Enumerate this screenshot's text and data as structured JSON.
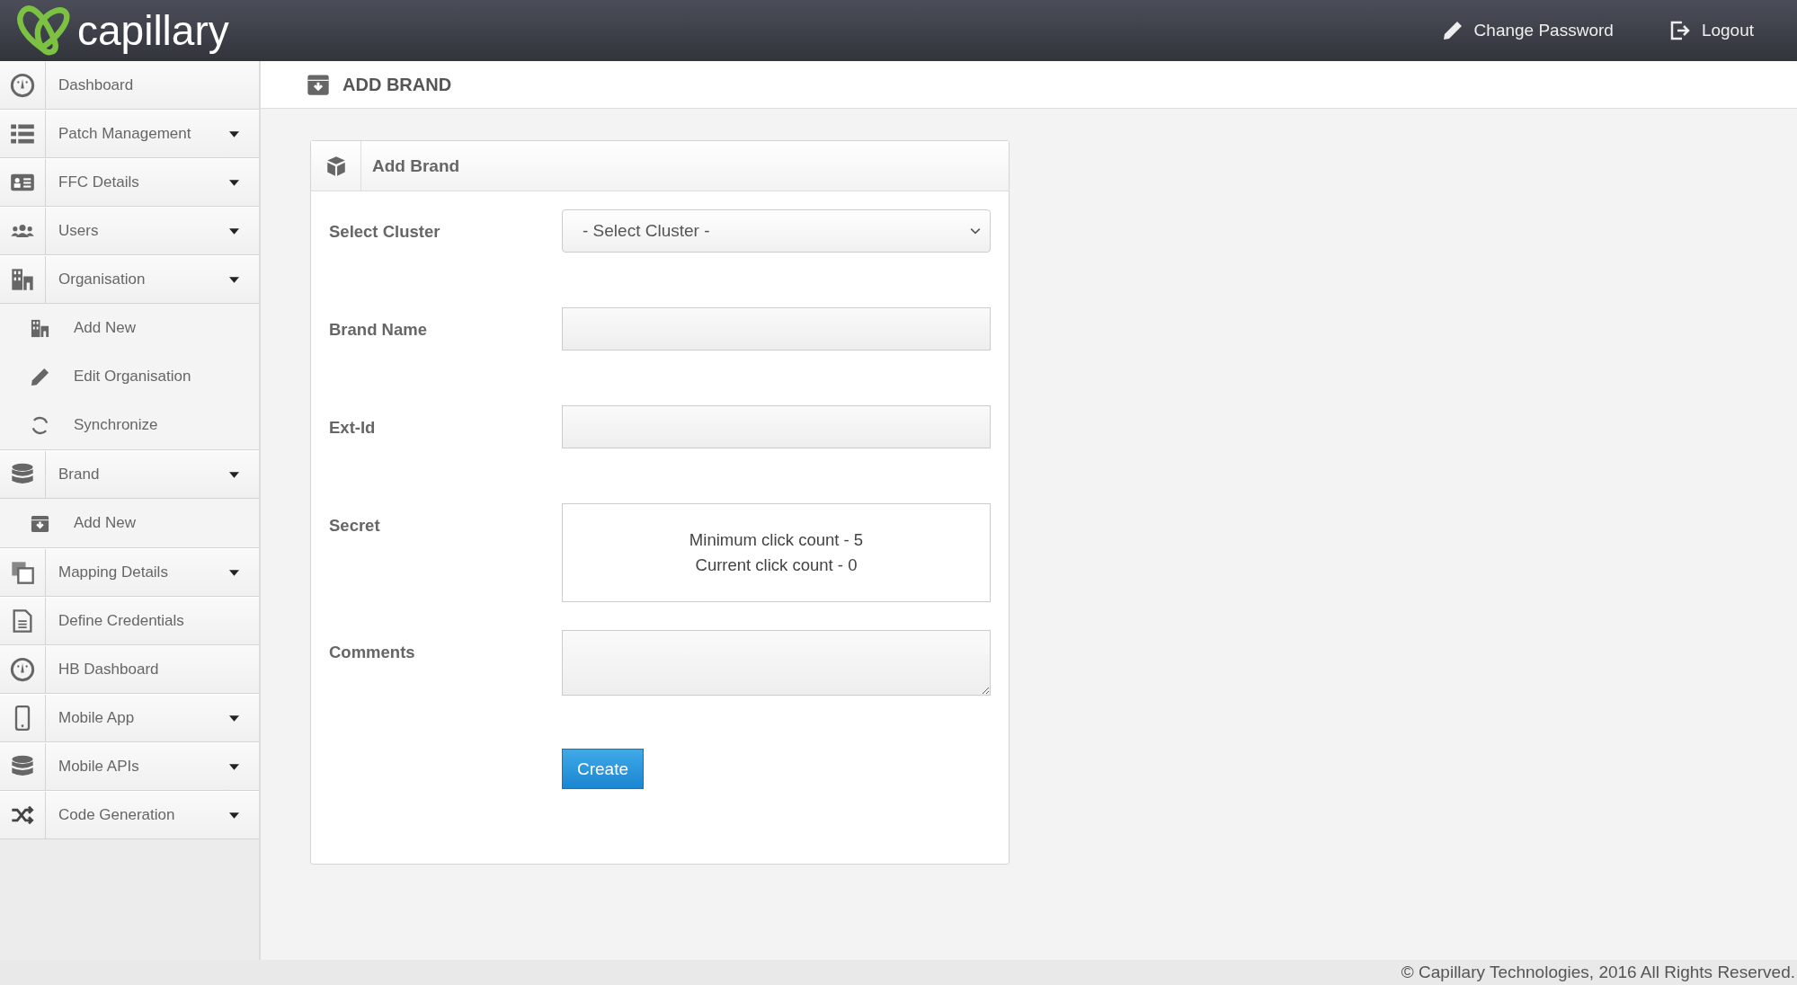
{
  "header": {
    "logo": "capillary",
    "links": [
      {
        "label": "Change Password"
      },
      {
        "label": "Logout"
      }
    ]
  },
  "sidebar": {
    "items": [
      {
        "label": "Dashboard",
        "dropdown": false
      },
      {
        "label": "Patch Management",
        "dropdown": true
      },
      {
        "label": "FFC Details",
        "dropdown": true
      },
      {
        "label": "Users",
        "dropdown": true
      },
      {
        "label": "Organisation",
        "dropdown": true,
        "children": [
          {
            "label": "Add New"
          },
          {
            "label": "Edit Organisation"
          },
          {
            "label": "Synchronize"
          }
        ]
      },
      {
        "label": "Brand",
        "dropdown": true,
        "children": [
          {
            "label": "Add New"
          }
        ]
      },
      {
        "label": "Mapping Details",
        "dropdown": true
      },
      {
        "label": "Define Credentials",
        "dropdown": false
      },
      {
        "label": "HB Dashboard",
        "dropdown": false
      },
      {
        "label": "Mobile App",
        "dropdown": true
      },
      {
        "label": "Mobile APIs",
        "dropdown": true
      },
      {
        "label": "Code Generation",
        "dropdown": true
      }
    ]
  },
  "page": {
    "title": "ADD BRAND"
  },
  "form": {
    "title": "Add Brand",
    "fields": [
      {
        "label": "Select Cluster",
        "kind": "select",
        "value": "- Select Cluster -"
      },
      {
        "label": "Brand Name",
        "kind": "text"
      },
      {
        "label": "Ext-Id",
        "kind": "text"
      },
      {
        "label": "Secret",
        "kind": "secret",
        "lines": [
          "Minimum click count - 5",
          "Current click count - 0"
        ]
      },
      {
        "label": "Comments",
        "kind": "textarea"
      }
    ],
    "submit": "Create"
  },
  "footer": "© Capillary Technologies, 2016 All Rights Reserved."
}
